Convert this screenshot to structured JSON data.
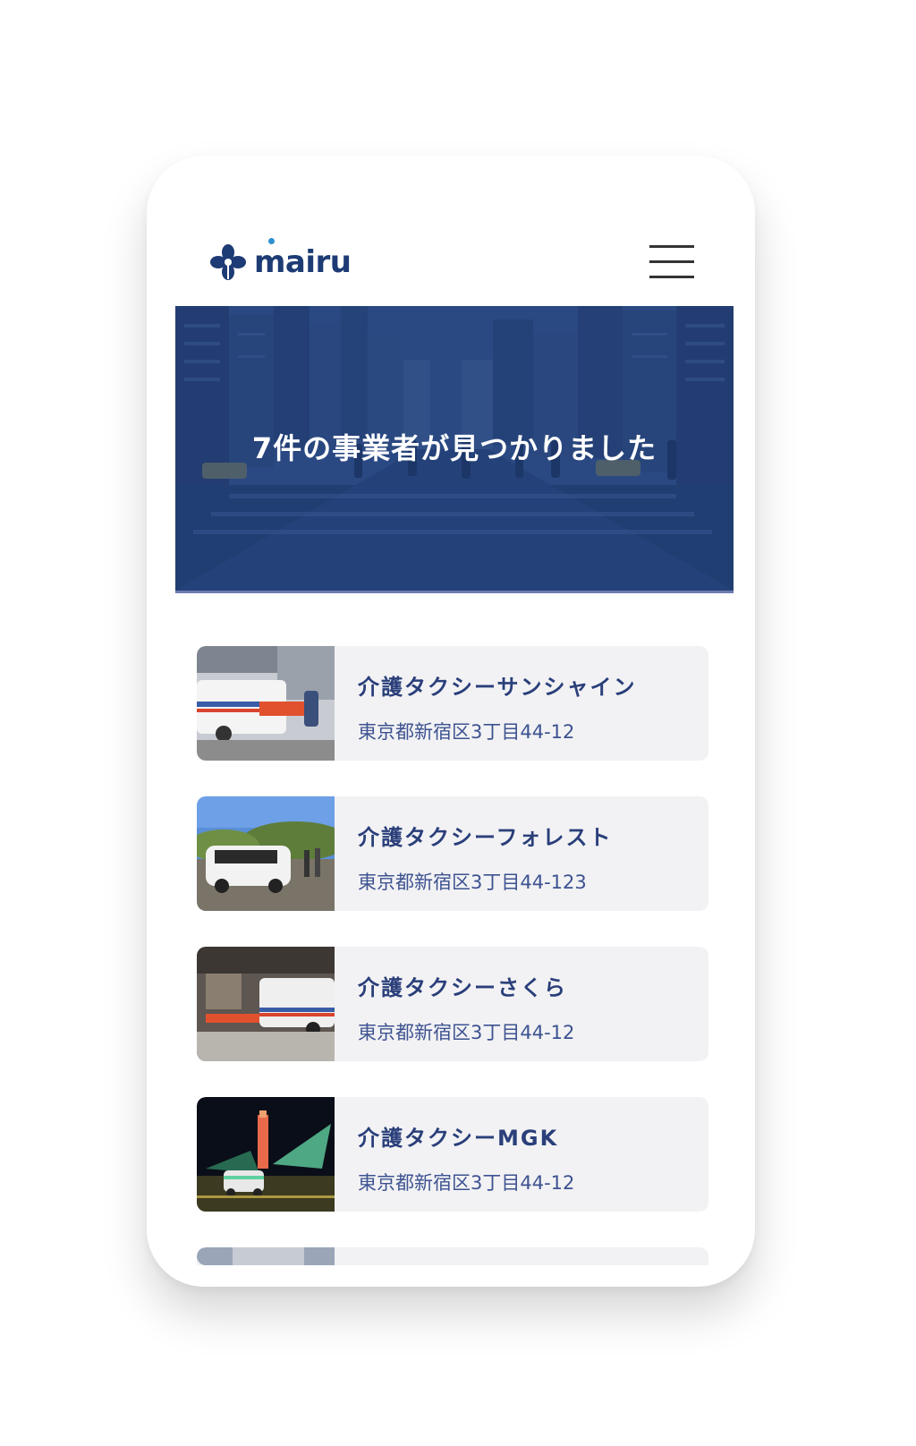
{
  "header": {
    "logo_text": "mairu",
    "menu_icon": "hamburger-menu-icon"
  },
  "hero": {
    "title": "7件の事業者が見つかりました",
    "overlay_color": "#2b4c84"
  },
  "results": [
    {
      "name": "介護タクシーサンシャイン",
      "address": "東京都新宿区3丁目44-12",
      "photo": "ambulance-loading-stretcher"
    },
    {
      "name": "介護タクシーフォレスト",
      "address": "東京都新宿区3丁目44-123",
      "photo": "white-minivan-park"
    },
    {
      "name": "介護タクシーさくら",
      "address": "東京都新宿区3丁目44-12",
      "photo": "ambulance-garage"
    },
    {
      "name": "介護タクシーMGK",
      "address": "東京都新宿区3丁目44-12",
      "photo": "van-night-tower"
    }
  ],
  "colors": {
    "brand_navy": "#1d3b74",
    "card_bg": "#f2f2f4",
    "text_blue": "#2a3f7a"
  }
}
